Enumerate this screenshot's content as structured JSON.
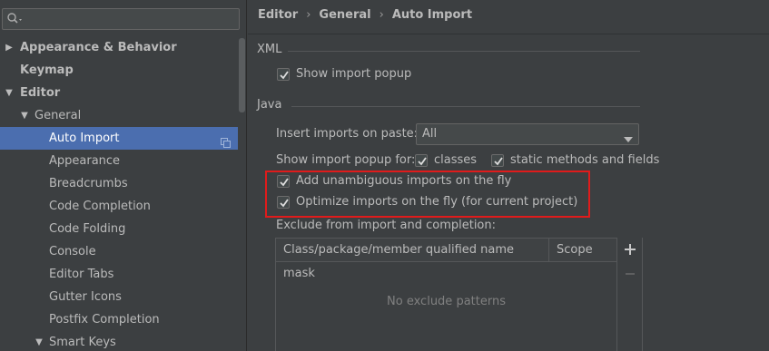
{
  "search": {
    "placeholder": "",
    "value": ""
  },
  "sidebar": {
    "items": [
      {
        "label": "Appearance & Behavior",
        "bold": true,
        "arrow": "▶",
        "level": 0
      },
      {
        "label": "Keymap",
        "bold": true,
        "arrow": "",
        "level": 0
      },
      {
        "label": "Editor",
        "bold": true,
        "arrow": "▼",
        "level": 0
      },
      {
        "label": "General",
        "bold": false,
        "arrow": "▼",
        "level": 1
      },
      {
        "label": "Auto Import",
        "bold": false,
        "arrow": "",
        "level": 2,
        "selected": true
      },
      {
        "label": "Appearance",
        "bold": false,
        "arrow": "",
        "level": 2
      },
      {
        "label": "Breadcrumbs",
        "bold": false,
        "arrow": "",
        "level": 2
      },
      {
        "label": "Code Completion",
        "bold": false,
        "arrow": "",
        "level": 2
      },
      {
        "label": "Code Folding",
        "bold": false,
        "arrow": "",
        "level": 2
      },
      {
        "label": "Console",
        "bold": false,
        "arrow": "",
        "level": 2
      },
      {
        "label": "Editor Tabs",
        "bold": false,
        "arrow": "",
        "level": 2
      },
      {
        "label": "Gutter Icons",
        "bold": false,
        "arrow": "",
        "level": 2
      },
      {
        "label": "Postfix Completion",
        "bold": false,
        "arrow": "",
        "level": 2
      },
      {
        "label": "Smart Keys",
        "bold": false,
        "arrow": "▼",
        "level": 2
      }
    ]
  },
  "breadcrumb": {
    "parts": [
      "Editor",
      "General",
      "Auto Import"
    ],
    "separator": "›"
  },
  "xml": {
    "section_title": "XML",
    "show_import_popup": {
      "label": "Show import popup",
      "checked": true
    }
  },
  "java": {
    "section_title": "Java",
    "insert_imports_label": "Insert imports on paste:",
    "insert_imports_value": "All",
    "show_popup_for_label": "Show import popup for:",
    "classes": {
      "label": "classes",
      "checked": true
    },
    "static_methods": {
      "label": "static methods and fields",
      "checked": true
    },
    "add_unambiguous": {
      "label": "Add unambiguous imports on the fly",
      "checked": true
    },
    "optimize_imports": {
      "label": "Optimize imports on the fly (for current project)",
      "checked": true
    },
    "exclude_label": "Exclude from import and completion:",
    "table": {
      "columns": [
        "Class/package/member qualified name mask",
        "Scope"
      ],
      "empty_text": "No exclude patterns"
    }
  },
  "colors": {
    "selection": "#4b6eaf",
    "highlight_box": "#e01b1b",
    "background": "#3c3f41"
  }
}
